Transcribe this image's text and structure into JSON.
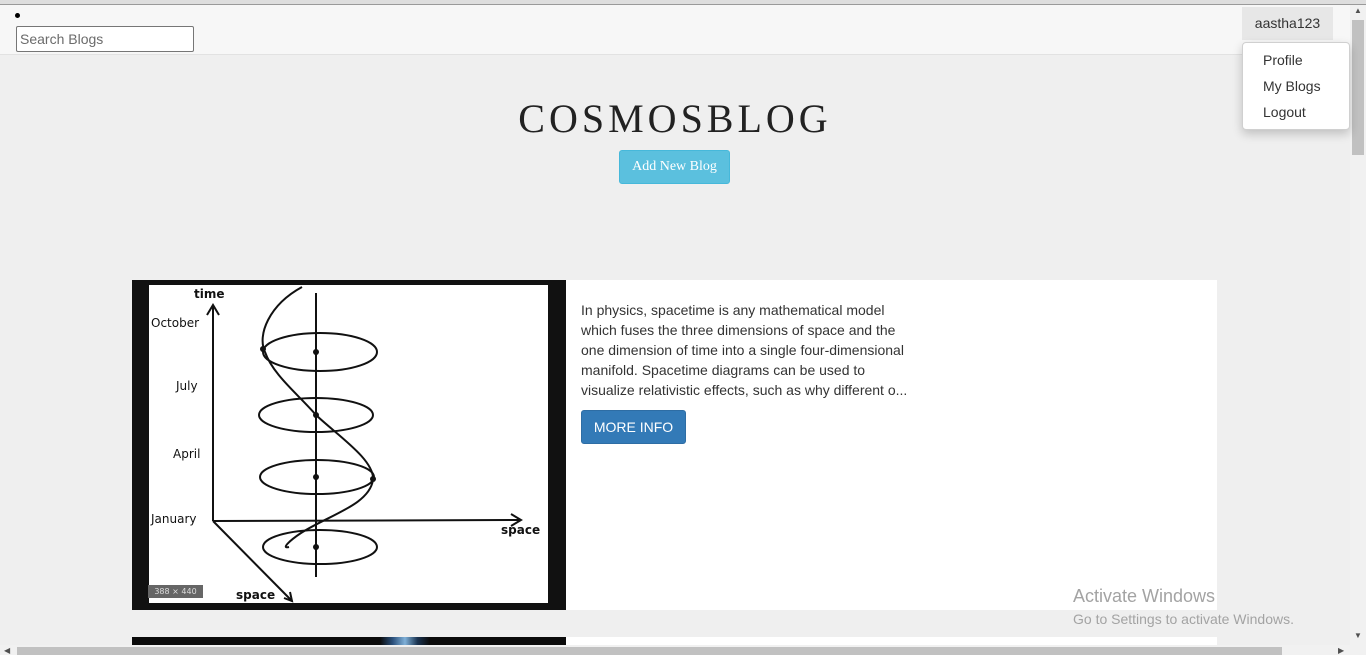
{
  "navbar": {
    "search_placeholder": "Search Blogs",
    "user_name": "aastha123",
    "dropdown": [
      "Profile",
      "My Blogs",
      "Logout"
    ]
  },
  "header": {
    "title": "COSMOSBLOG",
    "add_button": "Add New Blog"
  },
  "posts": [
    {
      "image_text": {
        "time": "time",
        "months": [
          "October",
          "July",
          "April",
          "January"
        ],
        "space_right": "space",
        "space_bottom": "space",
        "badge": "388 × 440"
      },
      "description": "In physics, spacetime is any mathematical model which fuses the three dimensions of space and the one dimension of time into a single four-dimensional manifold. Spacetime diagrams can be used to visualize relativistic effects, such as why different o...",
      "button": "MORE INFO"
    }
  ],
  "watermark": {
    "line1": "Activate Windows",
    "line2": "Go to Settings to activate Windows."
  },
  "colors": {
    "add_button": "#5bc0de",
    "more_info_button": "#337ab7",
    "page_background": "#efefef"
  }
}
